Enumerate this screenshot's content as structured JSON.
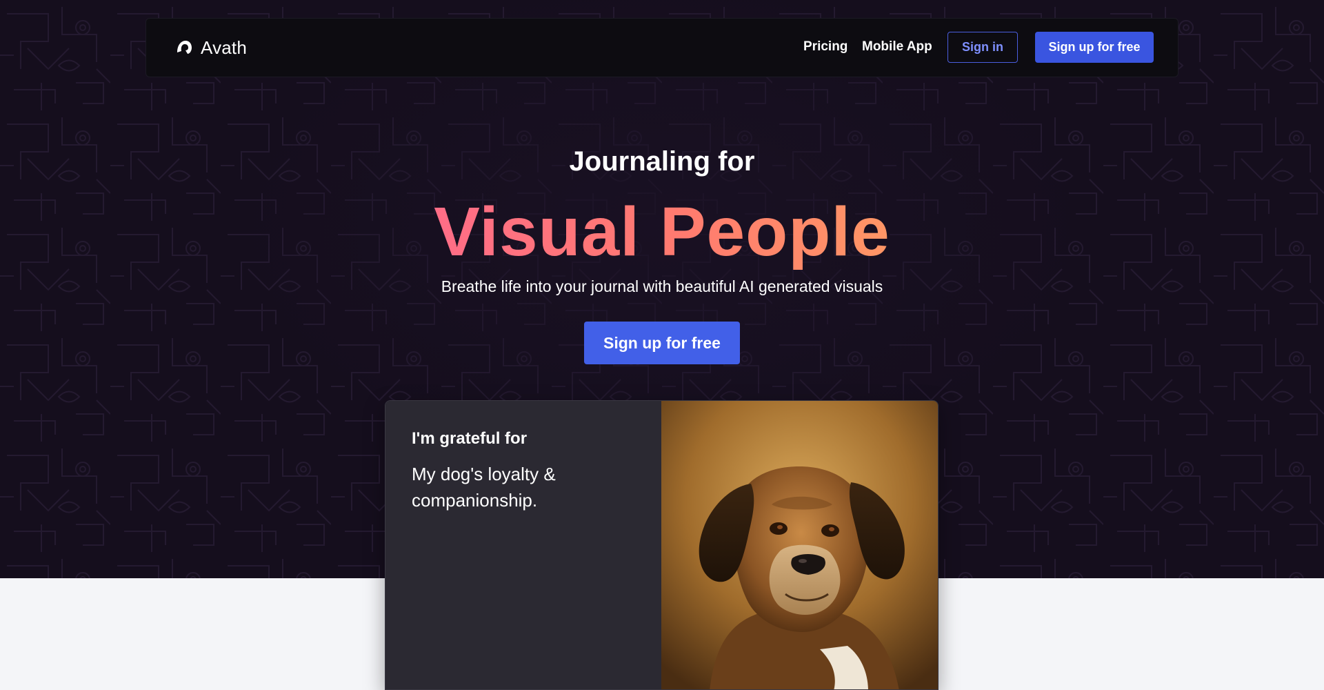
{
  "nav": {
    "brand": "Avath",
    "brand_icon": "avath-logo-icon",
    "links": [
      "Pricing",
      "Mobile App"
    ],
    "signin_label": "Sign in",
    "signup_label": "Sign up for free"
  },
  "hero": {
    "eyebrow": "Journaling for",
    "headline": "Visual People",
    "subtitle": "Breathe life into your journal with beautiful AI generated visuals",
    "cta_label": "Sign up for free"
  },
  "card": {
    "heading": "I'm grateful for",
    "entry_line1": "My dog's loyalty &",
    "entry_line2": "companionship."
  },
  "colors": {
    "hero_bg": "#150e1d",
    "accent_blue": "#4260e8",
    "headline_gradient_start": "#ff6d87",
    "headline_gradient_end": "#ff9665",
    "lower_bg": "#f4f5f8"
  }
}
